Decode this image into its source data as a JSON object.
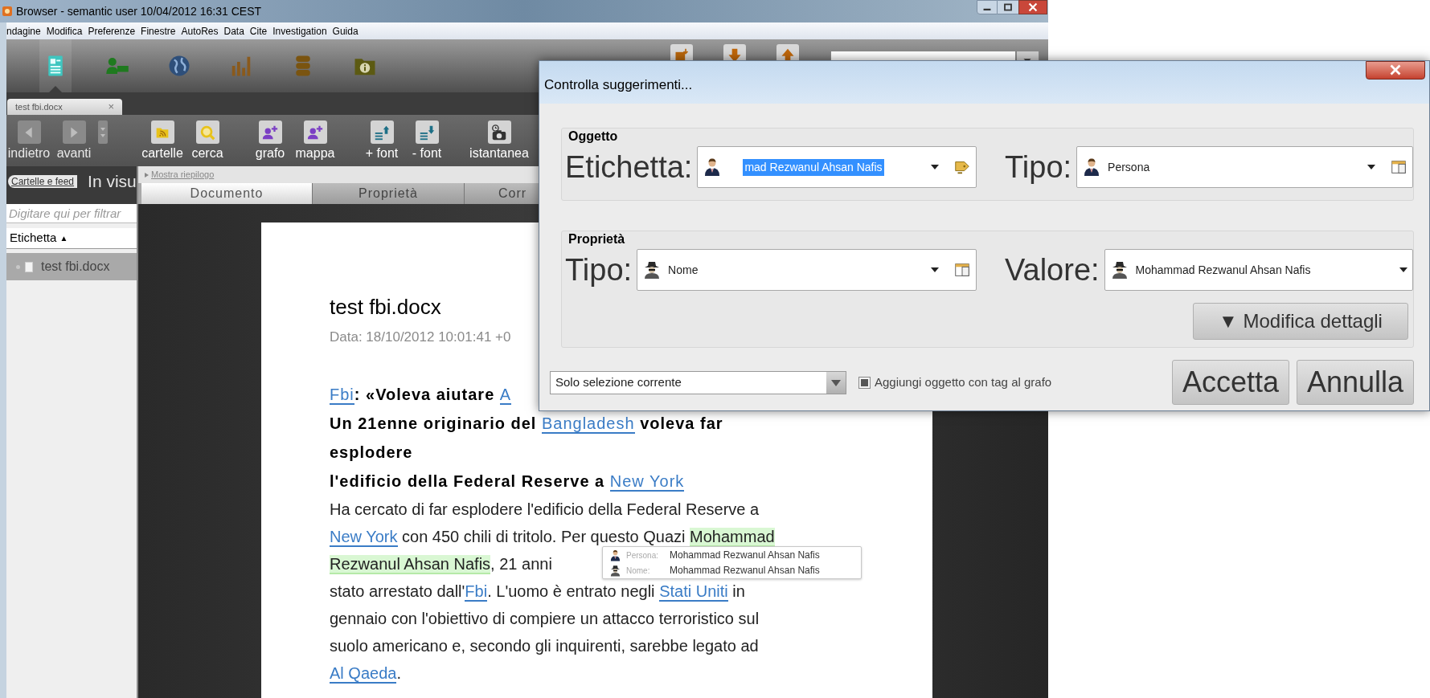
{
  "window": {
    "title": "Browser - semantic user 10/04/2012 16:31 CEST"
  },
  "menu": [
    "ndagine",
    "Modifica",
    "Preferenze",
    "Finestre",
    "AutoRes",
    "Data",
    "Cite",
    "Investigation",
    "Guida"
  ],
  "perspectives": [
    {
      "selected": true
    },
    {
      "selected": false
    },
    {
      "selected": false
    },
    {
      "selected": false
    },
    {
      "selected": false
    },
    {
      "selected": false
    }
  ],
  "doc_tab": {
    "label": "test fbi.docx",
    "close": "×"
  },
  "toolbar": [
    [
      {
        "label": "indietro",
        "disabled": true
      },
      {
        "label": "avanti",
        "disabled": true
      }
    ],
    [
      {
        "label": "cartelle",
        "disabled": false
      },
      {
        "label": "cerca",
        "disabled": false
      }
    ],
    [
      {
        "label": "grafo",
        "disabled": false
      },
      {
        "label": "mappa",
        "disabled": false
      }
    ],
    [
      {
        "label": "+ font",
        "disabled": false
      },
      {
        "label": "- font",
        "disabled": false
      }
    ],
    [
      {
        "label": "istantanea",
        "disabled": false
      }
    ]
  ],
  "sidebar": {
    "back_button": "Cartelle e feed",
    "heading": "In visu",
    "filter_placeholder": "Digitare qui per filtrar",
    "column": "Etichetta",
    "sort": "▲",
    "items": [
      {
        "label": "test fbi.docx",
        "selected": true
      }
    ]
  },
  "summary_link": "Mostra riepilogo",
  "view_tabs": [
    {
      "label": "Documento",
      "selected": true
    },
    {
      "label": "Proprietà",
      "selected": false
    },
    {
      "label": "Corr",
      "selected": false
    }
  ],
  "document": {
    "title": "test fbi.docx",
    "date": "Data: 18/10/2012 10:01:41 +0",
    "lines": [
      {
        "kind": "heading",
        "parts": [
          {
            "text": "Fbi",
            "kind": "entity"
          },
          {
            "text": ": «Voleva aiutare ",
            "kind": "plain"
          },
          {
            "text": "A",
            "kind": "entity"
          }
        ]
      },
      {
        "kind": "heading",
        "parts": [
          {
            "text": "Un 21enne originario del ",
            "kind": "plain"
          },
          {
            "text": "Bangladesh",
            "kind": "entity"
          },
          {
            "text": " voleva far",
            "kind": "plain"
          }
        ]
      },
      {
        "kind": "heading",
        "parts": [
          {
            "text": "esplodere",
            "kind": "plain"
          }
        ]
      },
      {
        "kind": "heading",
        "parts": [
          {
            "text": "l'edificio della Federal Reserve a ",
            "kind": "plain"
          },
          {
            "text": "New York",
            "kind": "entity"
          }
        ]
      },
      {
        "kind": "body",
        "parts": [
          {
            "text": "Ha cercato di far esplodere l'edificio della Federal Reserve a",
            "kind": "plain"
          }
        ]
      },
      {
        "kind": "body",
        "parts": [
          {
            "text": "New York",
            "kind": "entity"
          },
          {
            "text": " con 450 chili di tritolo. Per questo Quazi ",
            "kind": "plain"
          },
          {
            "text": "Mohammad",
            "kind": "highlight"
          }
        ]
      },
      {
        "kind": "body",
        "parts": [
          {
            "text": "Rezwanul Ahsan Nafis",
            "kind": "highlight"
          },
          {
            "text": ", 21 anni",
            "kind": "plain"
          }
        ]
      },
      {
        "kind": "body",
        "parts": [
          {
            "text": "stato arrestato dall'",
            "kind": "plain"
          },
          {
            "text": "Fbi",
            "kind": "entity"
          },
          {
            "text": ". L'uomo è entrato negli ",
            "kind": "plain"
          },
          {
            "text": "Stati Uniti",
            "kind": "entity"
          },
          {
            "text": " in",
            "kind": "plain"
          }
        ]
      },
      {
        "kind": "body",
        "parts": [
          {
            "text": "gennaio con l'obiettivo di compiere un attacco terroristico sul",
            "kind": "plain"
          }
        ]
      },
      {
        "kind": "body",
        "parts": [
          {
            "text": "suolo americano e, secondo gli inquirenti, sarebbe legato ad",
            "kind": "plain"
          }
        ]
      },
      {
        "kind": "body",
        "parts": [
          {
            "text": "Al Qaeda",
            "kind": "entity"
          },
          {
            "text": ".",
            "kind": "plain"
          }
        ]
      }
    ]
  },
  "tooltip": {
    "rows": [
      {
        "label": "Persona:",
        "value": "Mohammad Rezwanul Ahsan Nafis"
      },
      {
        "label": "Nome:",
        "value": "Mohammad Rezwanul Ahsan Nafis"
      }
    ]
  },
  "dialog": {
    "title": "Controlla suggerimenti...",
    "groups": [
      {
        "title": "Oggetto",
        "fields": [
          {
            "label": "Etichetta:",
            "value": "mad Rezwanul Ahsan Nafis",
            "text_selected": true
          },
          {
            "label": "Tipo:",
            "value": "Persona",
            "text_selected": false
          }
        ]
      },
      {
        "title": "Proprietà",
        "fields": [
          {
            "label": "Tipo:",
            "value": "Nome",
            "text_selected": false
          },
          {
            "label": "Valore:",
            "value": "Mohammad Rezwanul Ahsan Nafis",
            "text_selected": false
          }
        ]
      }
    ],
    "details_button": "▼ Modifica dettagli",
    "scope": "Solo selezione corrente",
    "add_to_graph": {
      "label": "Aggiungi oggetto con tag al grafo",
      "checked": true
    },
    "buttons": [
      "Accetta",
      "Annulla"
    ]
  }
}
